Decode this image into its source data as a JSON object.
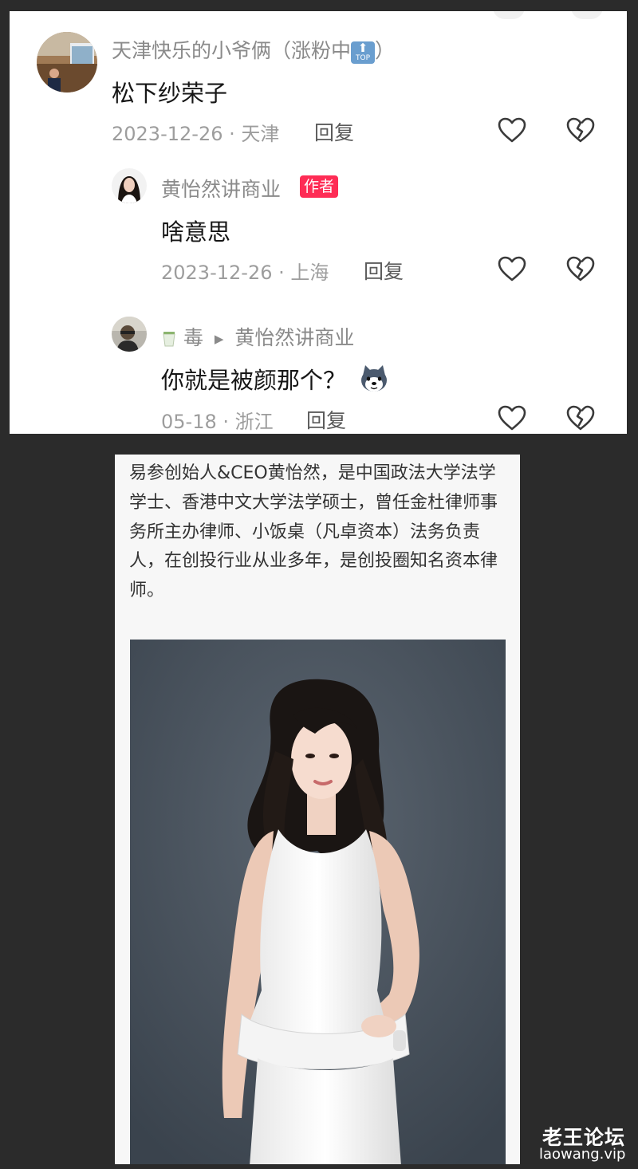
{
  "comments": [
    {
      "username": "天津快乐的小爷俩（涨粉中",
      "username_suffix": "）",
      "top_badge_label": "TOP",
      "text": "松下纱荣子",
      "date": "2023-12-26",
      "location": "天津",
      "reply_label": "回复"
    },
    {
      "username": "黄怡然讲商业",
      "author_badge": "作者",
      "text": "啥意思",
      "date": "2023-12-26",
      "location": "上海",
      "reply_label": "回复"
    },
    {
      "username": "毒",
      "reply_to": "黄怡然讲商业",
      "text": "你就是被颜那个？",
      "date": "05-18",
      "location": "浙江",
      "reply_label": "回复"
    }
  ],
  "separator": " · ",
  "icons": {
    "like": "heart-outline-icon",
    "dislike": "broken-heart-icon",
    "reply_arrow": "play-triangle-icon",
    "emoji": "husky-emoji-icon",
    "cup": "tea-cup-icon"
  },
  "article": {
    "paragraph": "易参创始人&CEO黄怡然，是中国政法大学法学学士、香港中文大学法学硕士，曾任金杜律师事务所主办律师、小饭桌（凡卓资本）法务负责人，在创投行业从业多年，是创投圈知名资本律师。"
  },
  "watermark": {
    "title": "老王论坛",
    "url": "laowang.vip"
  },
  "colors": {
    "author_badge": "#fe2c55",
    "page_background": "#2b2b2b",
    "card_background": "#ffffff",
    "meta_text": "#9d9d9d"
  }
}
